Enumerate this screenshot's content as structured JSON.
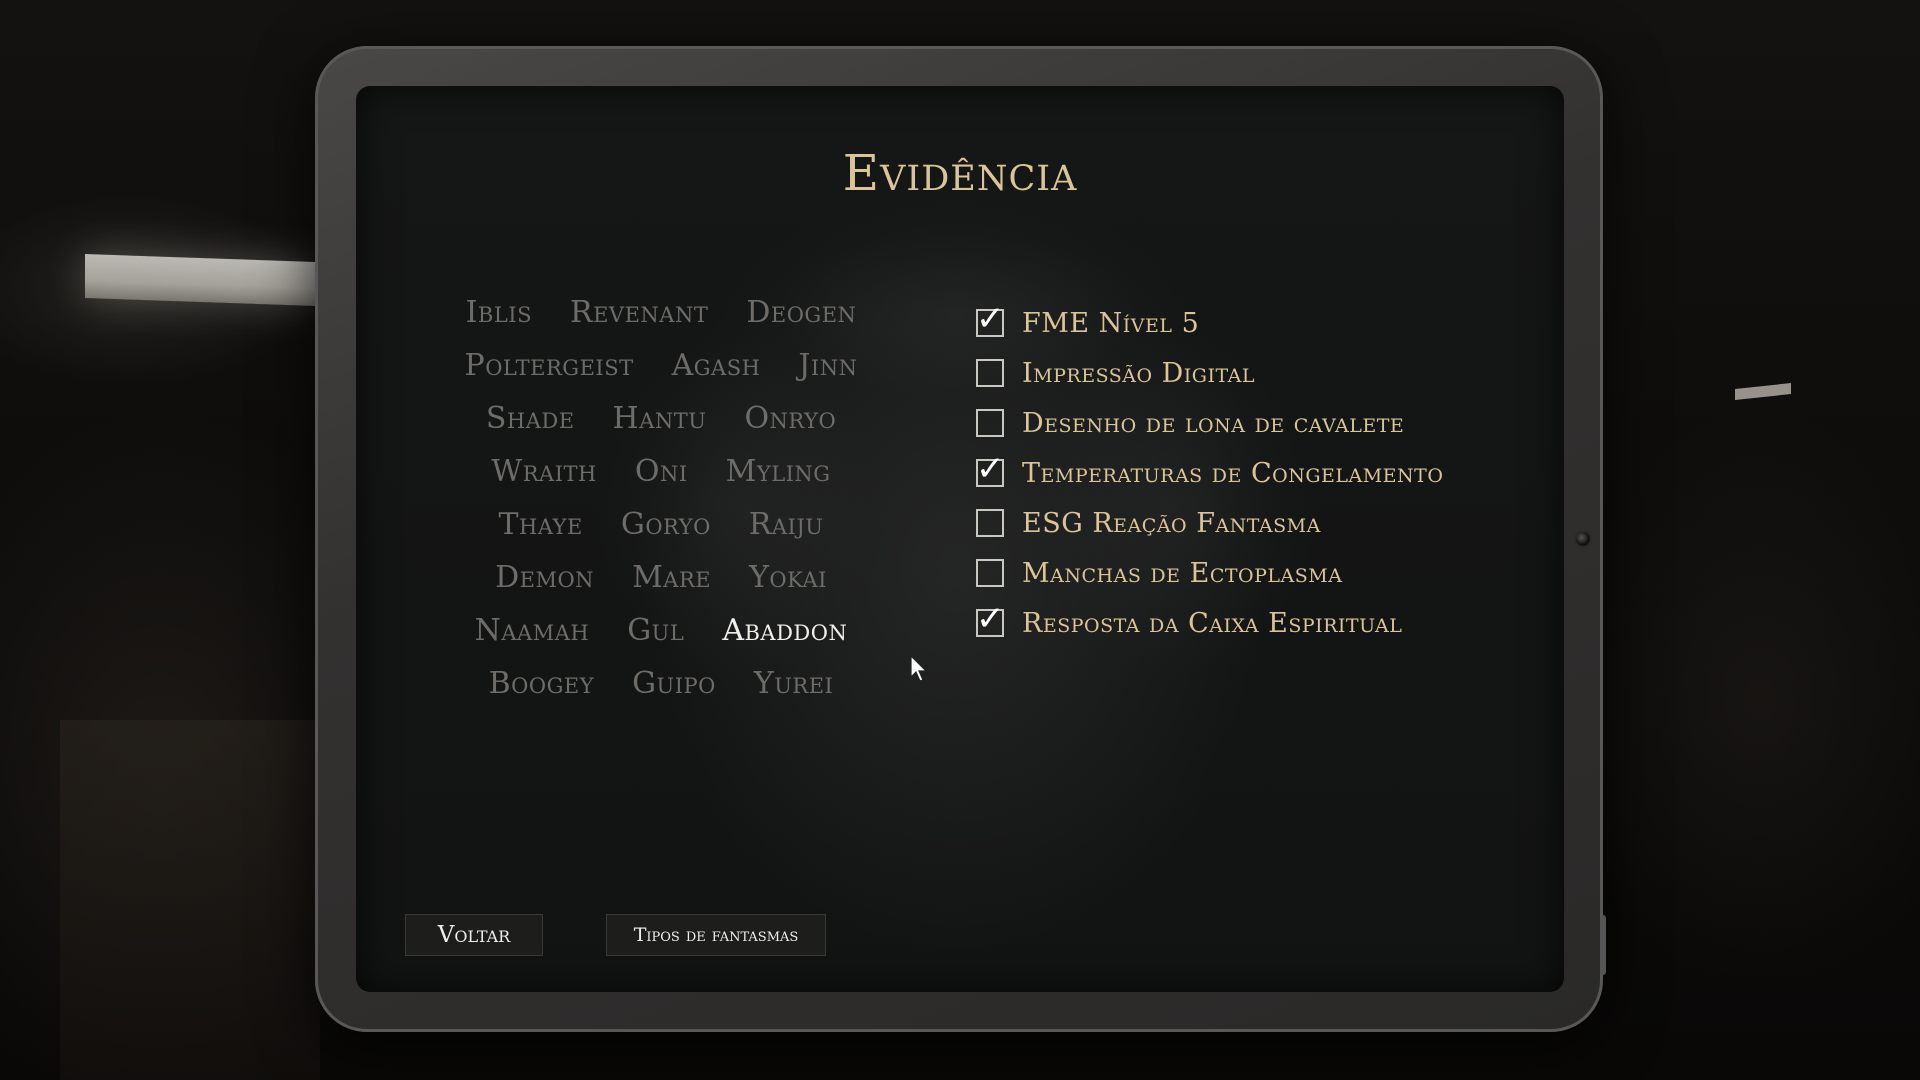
{
  "screen": {
    "title": "Evidência"
  },
  "ghosts": {
    "rows": [
      [
        "Iblis",
        "Revenant",
        "Deogen"
      ],
      [
        "Poltergeist",
        "Agash",
        "Jinn"
      ],
      [
        "Shade",
        "Hantu",
        "Onryo"
      ],
      [
        "Wraith",
        "Oni",
        "Myling"
      ],
      [
        "Thaye",
        "Goryo",
        "Raiju"
      ],
      [
        "Demon",
        "Mare",
        "Yokai"
      ],
      [
        "Naamah",
        "Gul",
        "Abaddon"
      ],
      [
        "Boogey",
        "Guipo",
        "Yurei"
      ]
    ],
    "highlighted": "Abaddon"
  },
  "evidence": {
    "items": [
      {
        "label": "FME Nível 5",
        "checked": true
      },
      {
        "label": "Impressão Digital",
        "checked": false
      },
      {
        "label": "Desenho de lona de cavalete",
        "checked": false
      },
      {
        "label": "Temperaturas de Congelamento",
        "checked": true
      },
      {
        "label": "ESG Reação Fantasma",
        "checked": false
      },
      {
        "label": "Manchas de Ectoplasma",
        "checked": false
      },
      {
        "label": "Resposta da Caixa Espiritual",
        "checked": true
      }
    ],
    "check_glyph": "✓"
  },
  "buttons": {
    "back_label": "Voltar",
    "types_label": "Tipos de fantasmas"
  },
  "colors": {
    "title": "#d9c597",
    "evidence_label": "#d9c597",
    "ghost_inactive": "#6e6c69",
    "ghost_active": "#f1efe9"
  }
}
